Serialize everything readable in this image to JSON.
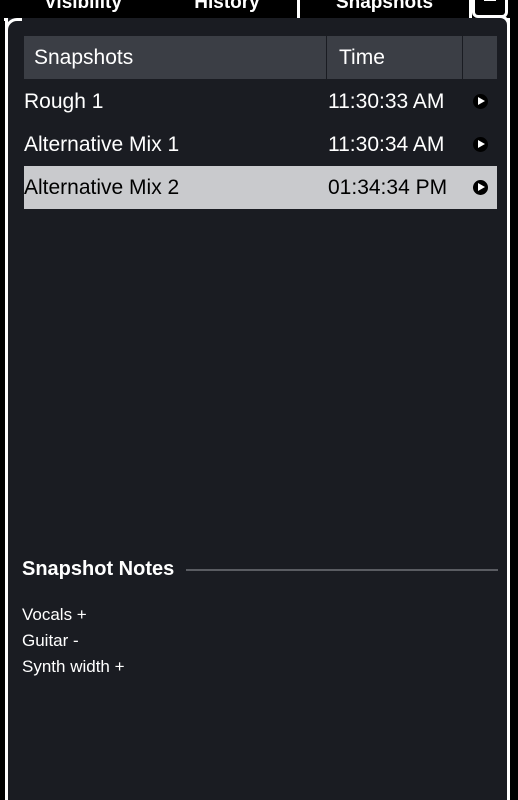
{
  "tabs": {
    "visibility": "Visibility",
    "history": "History",
    "snapshots": "Snapshots",
    "menu_icon": "hamburger-menu-icon"
  },
  "table": {
    "columns": [
      "Snapshots",
      "Time",
      ""
    ],
    "rows": [
      {
        "name": "Rough 1",
        "time": "11:30:33 AM",
        "selected": false,
        "action_icon": "play-icon"
      },
      {
        "name": "Alternative Mix 1",
        "time": "11:30:34 AM",
        "selected": false,
        "action_icon": "play-icon"
      },
      {
        "name": "Alternative Mix 2",
        "time": "01:34:34 PM",
        "selected": true,
        "action_icon": "play-icon"
      }
    ]
  },
  "notes": {
    "title": "Snapshot Notes",
    "lines": [
      "Vocals +",
      "Guitar -",
      "Synth width +"
    ]
  },
  "colors": {
    "panel_bg": "#1a1c22",
    "header_bg": "#3b3e45",
    "selected_row_bg": "#c9cacd",
    "border": "#ffffff"
  }
}
